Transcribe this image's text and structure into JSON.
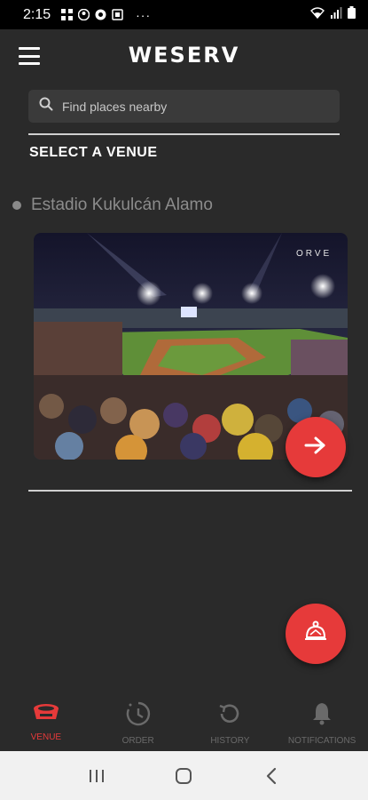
{
  "status_bar": {
    "time": "2:15",
    "dots": "···"
  },
  "header": {
    "brand": "WESERV",
    "menu_icon": "hamburger-menu-icon"
  },
  "search": {
    "placeholder": "Find places nearby",
    "icon": "search-icon"
  },
  "section": {
    "title": "SELECT A VENUE"
  },
  "venue": {
    "name": "Estadio Kukulcán Alamo",
    "photo_watermark": "ORVE",
    "next_icon": "arrow-right-icon"
  },
  "service_fab": {
    "icon": "waiter-bell-icon"
  },
  "bottom_nav": {
    "items": [
      {
        "label": "VENUE",
        "icon": "venue-stadium-icon",
        "active": true
      },
      {
        "label": "ORDER",
        "icon": "order-clock-icon",
        "active": false
      },
      {
        "label": "HISTORY",
        "icon": "history-icon",
        "active": false
      },
      {
        "label": "NOTIFICATIONS",
        "icon": "bell-icon",
        "active": false
      }
    ]
  },
  "system_nav": [
    "recents-icon",
    "home-icon",
    "back-icon"
  ],
  "colors": {
    "accent": "#e63a3a",
    "background": "#2a2a2a",
    "inactive": "#6a6a6a"
  }
}
